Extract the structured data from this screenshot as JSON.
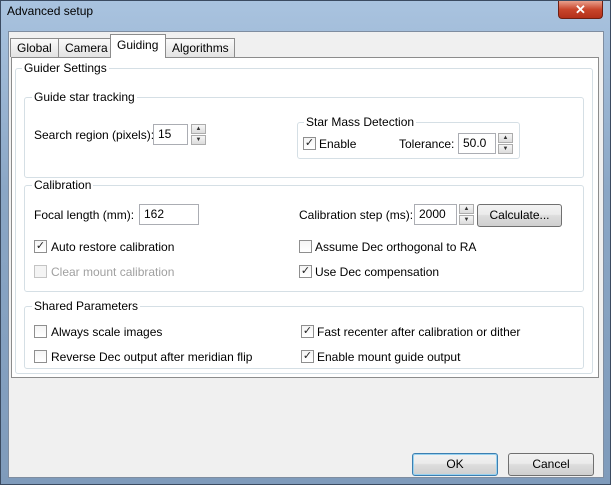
{
  "window": {
    "title": "Advanced setup",
    "close_glyph": "✕"
  },
  "tabs": [
    {
      "label": "Global"
    },
    {
      "label": "Camera"
    },
    {
      "label": "Guiding"
    },
    {
      "label": "Algorithms"
    }
  ],
  "guider": {
    "title": "Guider Settings",
    "star_tracking": {
      "title": "Guide star tracking",
      "search_region_label": "Search region (pixels):",
      "search_region_value": "15",
      "star_mass": {
        "title": "Star Mass Detection",
        "enable_label": "Enable",
        "enable_checked": true,
        "tolerance_label": "Tolerance:",
        "tolerance_value": "50.0"
      }
    },
    "calibration": {
      "title": "Calibration",
      "focal_length_label": "Focal length (mm):",
      "focal_length_value": "162",
      "calibration_step_label": "Calibration step (ms):",
      "calibration_step_value": "2000",
      "calculate_label": "Calculate...",
      "auto_restore_label": "Auto restore calibration",
      "auto_restore_checked": true,
      "assume_dec_label": "Assume Dec orthogonal to RA",
      "assume_dec_checked": false,
      "clear_mount_label": "Clear mount calibration",
      "clear_mount_checked": false,
      "use_dec_comp_label": "Use Dec compensation",
      "use_dec_comp_checked": true
    },
    "shared": {
      "title": "Shared Parameters",
      "always_scale_label": "Always scale images",
      "always_scale_checked": false,
      "fast_recenter_label": "Fast recenter after calibration or dither",
      "fast_recenter_checked": true,
      "reverse_dec_label": "Reverse Dec output after meridian flip",
      "reverse_dec_checked": false,
      "enable_mount_label": "Enable mount guide output",
      "enable_mount_checked": true
    }
  },
  "buttons": {
    "ok": "OK",
    "cancel": "Cancel"
  },
  "glyphs": {
    "check": "✓",
    "up": "▲",
    "down": "▼"
  }
}
